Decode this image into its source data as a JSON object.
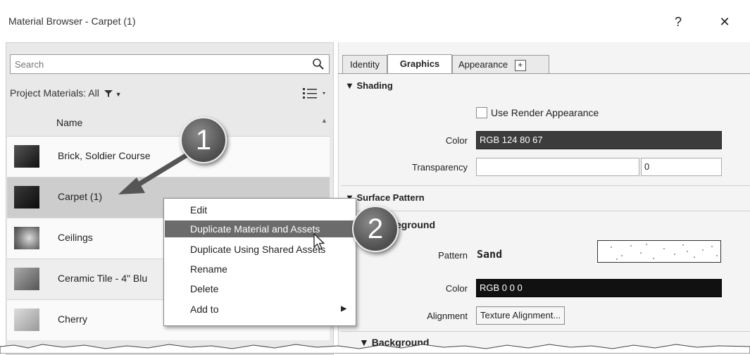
{
  "window": {
    "title": "Material Browser - Carpet (1)",
    "help_label": "?",
    "close_label": "✕"
  },
  "search": {
    "placeholder": "Search"
  },
  "filter": {
    "label": "Project Materials: All"
  },
  "list": {
    "column_header": "Name",
    "items": [
      {
        "label": "Brick, Soldier Course",
        "thumb_color": "#2a2a2a"
      },
      {
        "label": "Carpet (1)",
        "thumb_color": "#1f1f1f"
      },
      {
        "label": "Ceilings",
        "thumb_color": "#9a9a9a"
      },
      {
        "label": "Ceramic Tile - 4\" Blu",
        "thumb_color": "#8a8a8a"
      },
      {
        "label": "Cherry",
        "thumb_color": "#b5b5b5"
      }
    ]
  },
  "context_menu": {
    "items": [
      {
        "label": "Edit"
      },
      {
        "label": "Duplicate Material and Assets"
      },
      {
        "label": "Duplicate Using Shared Assets"
      },
      {
        "label": "Rename"
      },
      {
        "label": "Delete"
      },
      {
        "label": "Add to",
        "arrow": "▶"
      }
    ]
  },
  "callouts": {
    "one": "1",
    "two": "2"
  },
  "tabs": {
    "identity": "Identity",
    "graphics": "Graphics",
    "appearance": "Appearance",
    "add": "+"
  },
  "shading": {
    "header": "▼ Shading",
    "use_render_label": "Use Render Appearance",
    "color_label": "Color",
    "color_value": "RGB 124 80 67",
    "transparency_label": "Transparency",
    "transparency_value": "0"
  },
  "surface_pattern": {
    "header": "▼ Surface Pattern",
    "foreground_header": "eground",
    "pattern_label": "Pattern",
    "pattern_value": "Sand",
    "color_label": "Color",
    "color_value": "RGB 0 0 0",
    "alignment_label": "Alignment",
    "alignment_button": "Texture Alignment...",
    "background_header": "▼ Background"
  },
  "colors": {
    "selected_row": "#cdcdcd",
    "highlight": "#6b6b6b",
    "shading_color": "#3c3c3c"
  }
}
